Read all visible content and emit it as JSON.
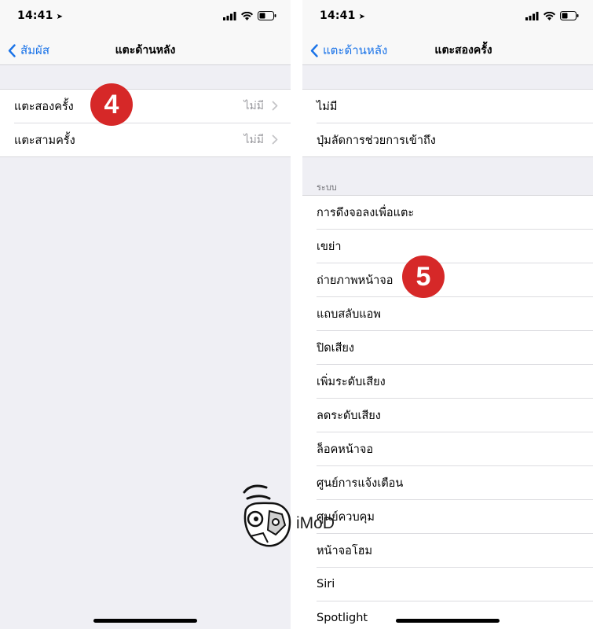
{
  "left": {
    "status": {
      "time": "14:41"
    },
    "nav": {
      "back_label": "สัมผัส",
      "title": "แตะด้านหลัง"
    },
    "rows": [
      {
        "label": "แตะสองครั้ง",
        "value": "ไม่มี"
      },
      {
        "label": "แตะสามครั้ง",
        "value": "ไม่มี"
      }
    ],
    "badge": "4"
  },
  "right": {
    "status": {
      "time": "14:41"
    },
    "nav": {
      "back_label": "แตะด้านหลัง",
      "title": "แตะสองครั้ง"
    },
    "top_rows": [
      {
        "label": "ไม่มี"
      },
      {
        "label": "ปุ่มลัดการช่วยการเข้าถึง"
      }
    ],
    "section_header": "ระบบ",
    "system_rows": [
      {
        "label": "การดึงจอลงเพื่อแตะ"
      },
      {
        "label": "เขย่า"
      },
      {
        "label": "ถ่ายภาพหน้าจอ"
      },
      {
        "label": "แถบสลับแอพ"
      },
      {
        "label": "ปิดเสียง"
      },
      {
        "label": "เพิ่มระดับเสียง"
      },
      {
        "label": "ลดระดับเสียง"
      },
      {
        "label": "ล็อคหน้าจอ"
      },
      {
        "label": "ศูนย์การแจ้งเตือน"
      },
      {
        "label": "ศูนย์ควบคุม"
      },
      {
        "label": "หน้าจอโฮม"
      },
      {
        "label": "Siri"
      },
      {
        "label": "Spotlight"
      }
    ],
    "badge": "5"
  },
  "watermark": {
    "text": "iMoD"
  },
  "colors": {
    "accent": "#1a73e8",
    "badge": "#d62828",
    "background": "#efeff4"
  }
}
